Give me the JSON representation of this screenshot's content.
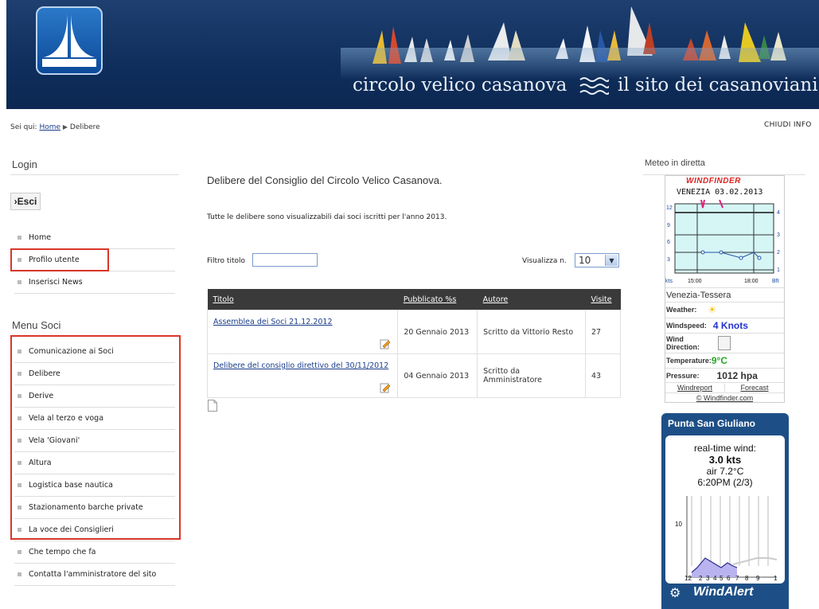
{
  "header": {
    "site_title": "circolo velico casanova",
    "site_subtitle": "il sito dei casanoviani"
  },
  "breadcrumb": {
    "prefix": "Sei qui:",
    "home": "Home",
    "current": "Delibere"
  },
  "close_info": "CHIUDI INFO",
  "login": {
    "title": "Login",
    "logout_label": "›Esci",
    "items": [
      "Home",
      "Profilo utente",
      "Inserisci News"
    ]
  },
  "menu_soci": {
    "title": "Menu Soci",
    "items": [
      "Comunicazione ai Soci",
      "Delibere",
      "Derive",
      "Vela al terzo e voga",
      "Vela 'Giovani'",
      "Altura",
      "Logistica base nautica",
      "Stazionamento barche private",
      "La voce dei Consiglieri",
      "Che tempo che fa",
      "Contatta l'amministratore del sito"
    ]
  },
  "main": {
    "title": "Delibere del Consiglio del Circolo Velico Casanova.",
    "intro": "Tutte le delibere sono visualizzabili dai soci iscritti per l'anno 2013.",
    "filter_label": "Filtro titolo",
    "filter_value": "",
    "view_label": "Visualizza n.",
    "view_value": "10",
    "columns": [
      "Titolo",
      "Pubblicato %s",
      "Autore",
      "Visite"
    ],
    "rows": [
      {
        "title": "Assemblea dei Soci 21.12.2012",
        "date": "20 Gennaio 2013",
        "author": "Scritto da Vittorio Resto",
        "visits": "27"
      },
      {
        "title": "Delibere del consiglio direttivo del 30/11/2012",
        "date": "04 Gennaio 2013",
        "author": "Scritto da Amministratore",
        "visits": "43"
      }
    ]
  },
  "meteo": {
    "title": "Meteo in diretta",
    "windfinder": {
      "brand": "WINDFINDER",
      "chart_title": "VENEZIA 03.02.2013",
      "y_left": [
        "12",
        "9",
        "6",
        "3"
      ],
      "y_right": [
        "4",
        "3",
        "2",
        "1"
      ],
      "x_labels": [
        "kts",
        "15:00",
        "18:00",
        "Bft"
      ],
      "station": "Venezia-Tessera",
      "weather_label": "Weather:",
      "windspeed_label": "Windspeed:",
      "windspeed_value": "4 Knots",
      "direction_label": "Wind Direction:",
      "temperature_label": "Temperature:",
      "temperature_value": "9°C",
      "pressure_label": "Pressure:",
      "pressure_value": "1012 hpa",
      "link_report": "Windreport",
      "link_forecast": "Forecast",
      "credit": "© Windfinder.com"
    },
    "windalert": {
      "station": "Punta San Giuliano",
      "realtime_label": "real-time wind:",
      "speed": "3.0 kts",
      "air": "air 7.2°C",
      "time": "6:20PM (2/3)",
      "y_tick": "10",
      "x_ticks": [
        "12",
        "2",
        "3",
        "4",
        "5",
        "6",
        "7",
        "8",
        "9",
        "1"
      ],
      "brand": "WindAlert"
    }
  },
  "colors": {
    "header_bg": "#0f2e5c",
    "highlight": "#d9362a",
    "table_header": "#3a3a3a",
    "link": "#1a3d8a",
    "windalert_bg": "#1d4f86",
    "windspeed": "#2233cc",
    "temperature": "#22aa22"
  }
}
